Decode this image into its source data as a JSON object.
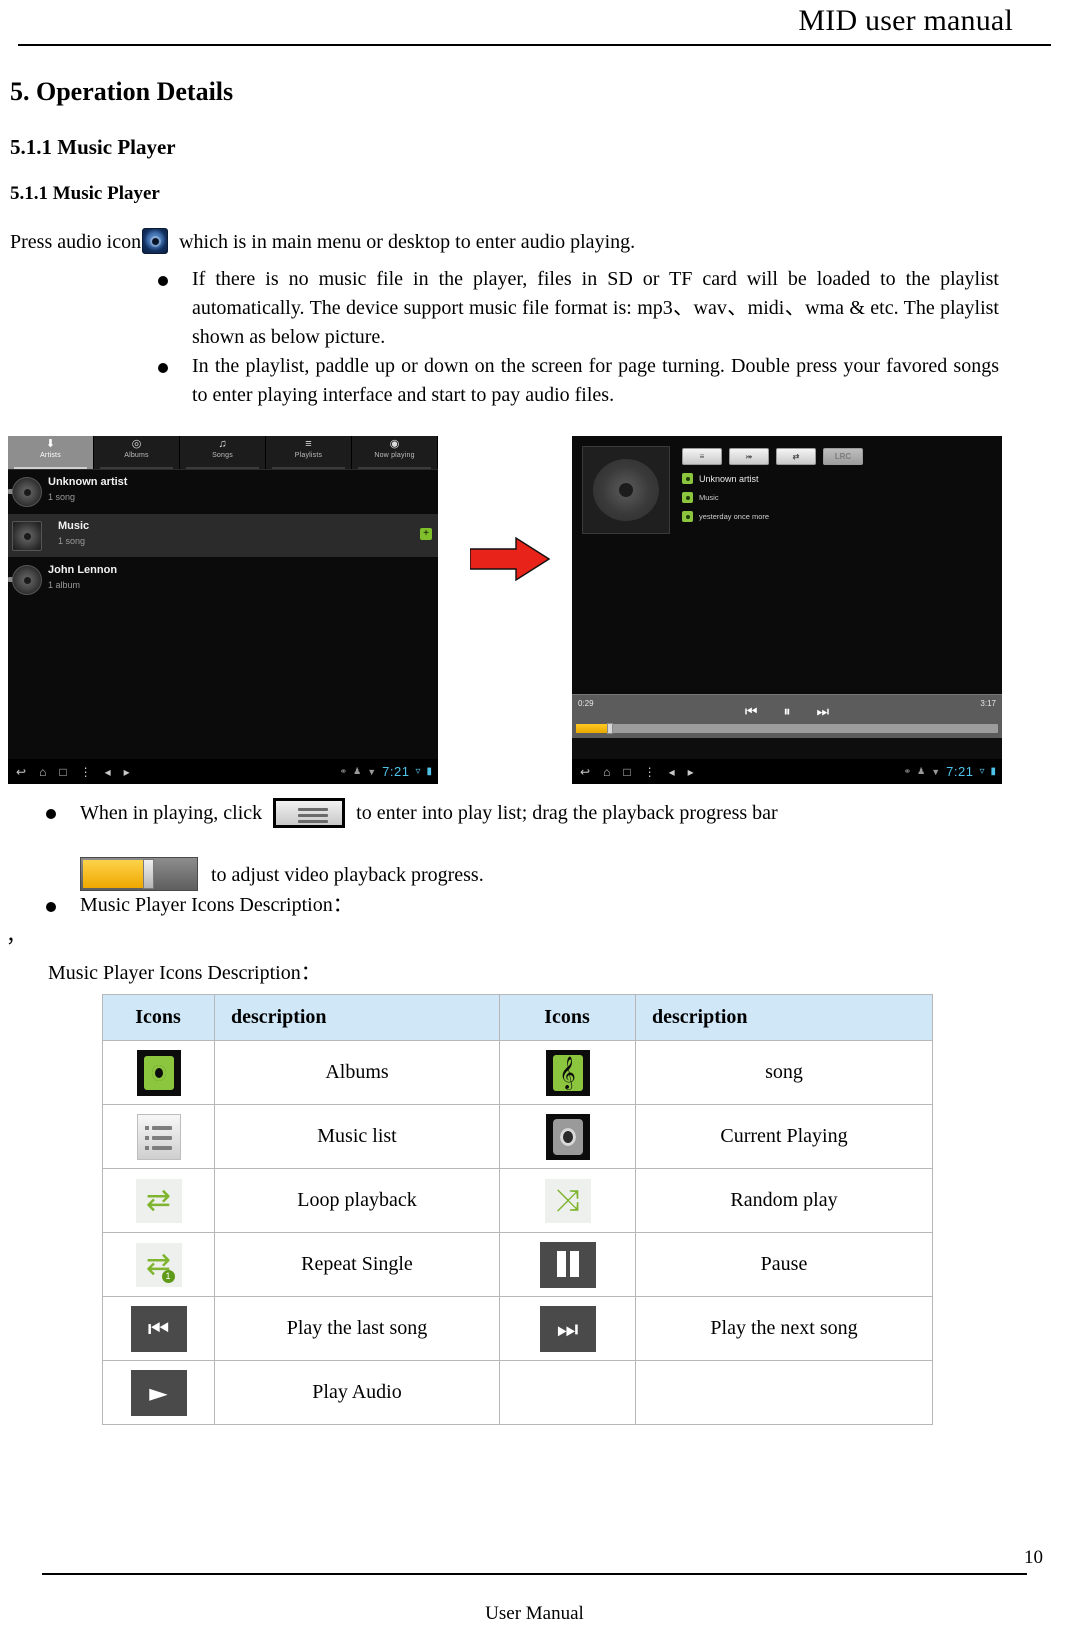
{
  "header": {
    "title": "MID user manual"
  },
  "section": {
    "number_title": "5. Operation Details",
    "sub_heading": "5.1.1 Music Player",
    "sub_heading2": "5.1.1 Music Player",
    "intro_before": "Press audio icon",
    "intro_after": "which is in main menu or desktop to enter audio playing."
  },
  "bullets": {
    "b1": "If there is no music file in the player, files in SD or TF card will be loaded to the playlist automatically. The device support music file format is: mp3、wav、midi、wma & etc. The playlist shown as below picture.",
    "b2": "In the playlist, paddle up or down on the screen for page turning. Double press your favored songs to enter playing interface and start to pay audio files.",
    "b3_part1": "When in playing, click",
    "b3_part2": "to enter into play list; drag the playback progress bar",
    "b3_part3": "to adjust video playback progress.",
    "b4": "Music Player Icons Description："
  },
  "stray_comma": "，",
  "table_caption": "Music Player Icons Description：",
  "left_device": {
    "tabs": [
      {
        "label": "Artists",
        "icon": "microphone-icon",
        "glyph": "⬇",
        "active": true
      },
      {
        "label": "Albums",
        "icon": "album-icon",
        "glyph": "◎",
        "active": false
      },
      {
        "label": "Songs",
        "icon": "music-note-icon",
        "glyph": "♫",
        "active": false
      },
      {
        "label": "Playlists",
        "icon": "playlist-icon",
        "glyph": "≡",
        "active": false
      },
      {
        "label": "Now playing",
        "icon": "now-playing-icon",
        "glyph": "◉",
        "active": false
      }
    ],
    "rows": [
      {
        "name": "Unknown artist",
        "sub": "1 song",
        "alt": false
      },
      {
        "name": "Music",
        "sub": "1 song",
        "alt": true
      },
      {
        "name": "John Lennon",
        "sub": "1 album",
        "alt": false
      }
    ],
    "navbar": {
      "back": "↩",
      "home": "⌂",
      "recents": "□",
      "menu": "⋮",
      "vol_down": "◂",
      "vol_up": "▸",
      "clock": "7:21"
    }
  },
  "right_device": {
    "buttons": [
      {
        "label": "",
        "icon": "playlist-icon"
      },
      {
        "label": "",
        "icon": "shuffle-icon"
      },
      {
        "label": "",
        "icon": "loop-icon"
      },
      {
        "label": "LRC",
        "icon": "lyrics-icon"
      }
    ],
    "meta": [
      {
        "text": "Unknown artist",
        "icon": "artist-icon",
        "small": false
      },
      {
        "text": "Music",
        "icon": "album-icon",
        "small": true
      },
      {
        "text": "yesterday once more",
        "icon": "song-icon",
        "small": true
      }
    ],
    "transport": {
      "prev": "⏮",
      "pause": "⏸",
      "next": "⏭",
      "elapsed": "0:29",
      "duration": "3:17",
      "progress_percent": 8
    },
    "navbar": {
      "back": "↩",
      "home": "⌂",
      "recents": "□",
      "menu": "⋮",
      "vol_down": "◂",
      "vol_up": "▸",
      "clock": "7:21"
    }
  },
  "table": {
    "headers": [
      "Icons",
      "description",
      "Icons",
      "description"
    ],
    "rows": [
      {
        "icon_left": "album-icon",
        "desc_left": "Albums",
        "icon_right": "song-icon",
        "desc_right": "song"
      },
      {
        "icon_left": "music-list-icon",
        "desc_left": "Music list",
        "icon_right": "current-playing-icon",
        "desc_right": "Current Playing"
      },
      {
        "icon_left": "loop-icon",
        "desc_left": "Loop playback",
        "icon_right": "shuffle-icon",
        "desc_right": "Random play"
      },
      {
        "icon_left": "repeat-one-icon",
        "desc_left": "Repeat Single",
        "icon_right": "pause-icon",
        "desc_right": "Pause"
      },
      {
        "icon_left": "previous-icon",
        "desc_left": "Play the last song",
        "icon_right": "next-icon",
        "desc_right": "Play the next song"
      },
      {
        "icon_left": "play-icon",
        "desc_left": "Play Audio",
        "icon_right": "",
        "desc_right": ""
      }
    ]
  },
  "footer": {
    "page_number": "10",
    "title": "User Manual"
  },
  "colors": {
    "table_header_bg": "#cfe7f7",
    "accent_green": "#8cc63e",
    "progress_yellow": "#f0a800",
    "clock_blue": "#4fc3e8",
    "arrow_red": "#e8231a"
  }
}
